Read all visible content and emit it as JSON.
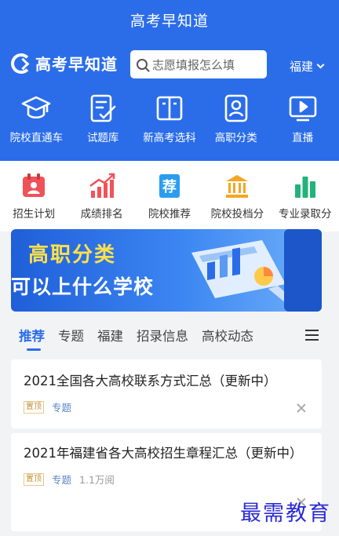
{
  "app": {
    "title": "高考早知道"
  },
  "header": {
    "logo_text": "高考早知道",
    "search_placeholder": "志愿填报怎么填",
    "region": "福建"
  },
  "primary_nav": [
    {
      "label": "院校直通车",
      "icon": "graduation-cap-icon"
    },
    {
      "label": "试题库",
      "icon": "checklist-icon"
    },
    {
      "label": "新高考选科",
      "icon": "open-book-icon"
    },
    {
      "label": "高职分类",
      "icon": "id-badge-icon"
    },
    {
      "label": "直播",
      "icon": "video-play-icon"
    }
  ],
  "secondary_nav": [
    {
      "label": "招生计划",
      "icon": "calendar-icon",
      "color": "#f0525a"
    },
    {
      "label": "成绩排名",
      "icon": "trend-chart-icon",
      "color": "#f0525a"
    },
    {
      "label": "院校推荐",
      "icon": "recommend-icon",
      "color": "#2b9df0",
      "glyph": "荐"
    },
    {
      "label": "院校投档分",
      "icon": "institution-icon",
      "color": "#f5a623"
    },
    {
      "label": "专业录取分",
      "icon": "bar-chart-icon",
      "color": "#22b37a"
    }
  ],
  "banner": {
    "line1": "高职分类",
    "line2": "可以上什么学校"
  },
  "tabs": [
    {
      "label": "推荐",
      "active": true
    },
    {
      "label": "专题"
    },
    {
      "label": "福建"
    },
    {
      "label": "招录信息"
    },
    {
      "label": "高校动态"
    }
  ],
  "articles": [
    {
      "title": "2021全国各大高校联系方式汇总（更新中）",
      "pin": "置顶",
      "category": "专题",
      "views": ""
    },
    {
      "title": "2021年福建省各大高校招生章程汇总（更新中）",
      "pin": "置顶",
      "category": "专题",
      "views": "1.1万阅"
    }
  ],
  "watermark": "最需教育",
  "colors": {
    "primary": "#2b6de9",
    "accent_yellow": "#ffe14a"
  }
}
